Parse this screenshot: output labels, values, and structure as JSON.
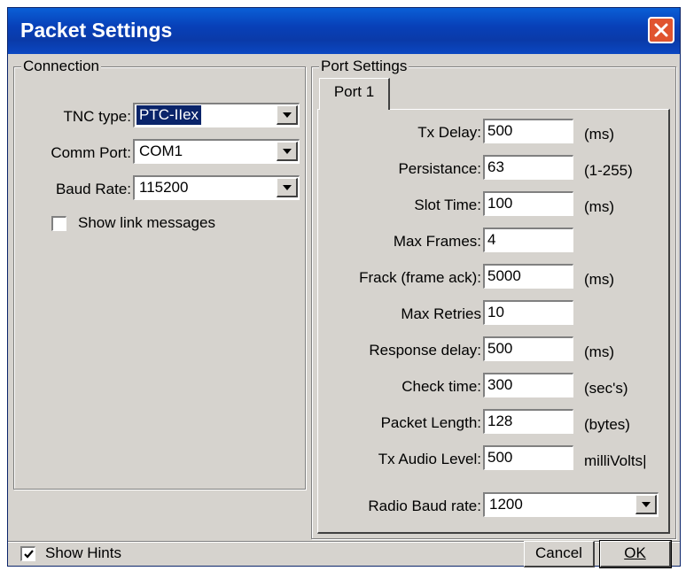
{
  "window": {
    "title": "Packet Settings",
    "close_label": "close"
  },
  "connection": {
    "legend": "Connection",
    "tnc_type": {
      "label": "TNC type:",
      "value": "PTC-IIex"
    },
    "comm_port": {
      "label": "Comm Port:",
      "value": "COM1"
    },
    "baud_rate": {
      "label": "Baud Rate:",
      "value": "115200"
    },
    "show_link_messages": {
      "label": "Show link messages",
      "checked": false
    }
  },
  "port_settings": {
    "legend": "Port Settings",
    "tabs": [
      {
        "label": "Port 1",
        "active": true
      }
    ],
    "fields": [
      {
        "label": "Tx Delay:",
        "value": "500",
        "unit": "(ms)"
      },
      {
        "label": "Persistance:",
        "value": "63",
        "unit": "(1-255)"
      },
      {
        "label": "Slot Time:",
        "value": "100",
        "unit": "(ms)"
      },
      {
        "label": "Max Frames:",
        "value": "4",
        "unit": ""
      },
      {
        "label": "Frack (frame ack):",
        "value": "5000",
        "unit": "(ms)"
      },
      {
        "label": "Max Retries",
        "value": "10",
        "unit": ""
      },
      {
        "label": "Response delay:",
        "value": "500",
        "unit": "(ms)"
      },
      {
        "label": "Check time:",
        "value": "300",
        "unit": "(sec's)"
      },
      {
        "label": "Packet Length:",
        "value": "128",
        "unit": "(bytes)"
      },
      {
        "label": "Tx Audio Level:",
        "value": "500",
        "unit": "milliVolts|"
      }
    ],
    "radio_baud_rate": {
      "label": "Radio Baud rate:",
      "value": "1200"
    }
  },
  "footer": {
    "show_hints": {
      "label": "Show Hints",
      "checked": true
    },
    "cancel_label": "Cancel",
    "ok_label": "OK"
  },
  "colors": {
    "titlebar": "#0a4ac6",
    "face": "#d6d3ce",
    "close": "#e0542f"
  }
}
